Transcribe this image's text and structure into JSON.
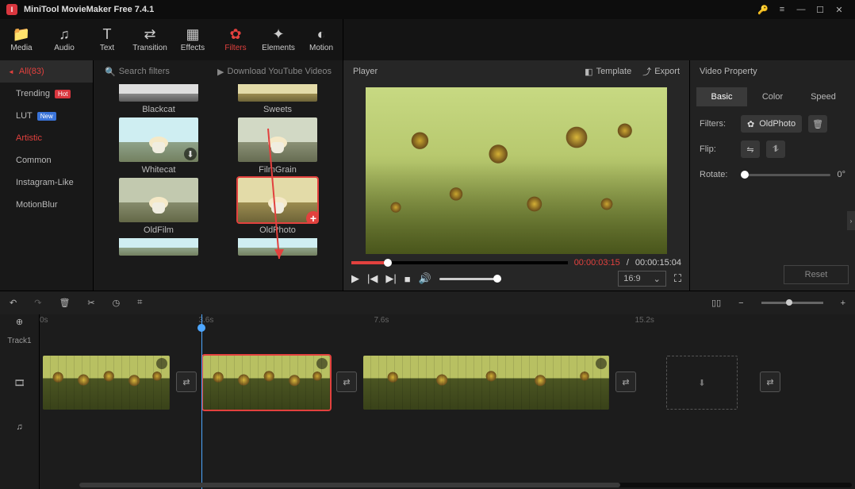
{
  "app": {
    "title": "MiniTool MovieMaker Free 7.4.1"
  },
  "toolbar": [
    {
      "icon": "📁",
      "label": "Media"
    },
    {
      "icon": "♫",
      "label": "Audio"
    },
    {
      "icon": "T",
      "label": "Text"
    },
    {
      "icon": "⇄",
      "label": "Transition"
    },
    {
      "icon": "▦",
      "label": "Effects"
    },
    {
      "icon": "✿",
      "label": "Filters",
      "active": true
    },
    {
      "icon": "✦",
      "label": "Elements"
    },
    {
      "icon": "◐",
      "label": "Motion"
    }
  ],
  "categories": {
    "head": "All(83)",
    "items": [
      {
        "label": "Trending",
        "badge": "Hot",
        "badgeClass": "hot"
      },
      {
        "label": "LUT",
        "badge": "New",
        "badgeClass": "new"
      },
      {
        "label": "Artistic",
        "active": true
      },
      {
        "label": "Common"
      },
      {
        "label": "Instagram-Like"
      },
      {
        "label": "MotionBlur"
      }
    ]
  },
  "search": {
    "placeholder": "Search filters"
  },
  "download": {
    "label": "Download YouTube Videos"
  },
  "filters": [
    {
      "name": "Blackcat",
      "style": "bw",
      "cut": true
    },
    {
      "name": "Sweets",
      "style": "sep",
      "cut": true
    },
    {
      "name": "Whitecat",
      "style": "",
      "dl": true
    },
    {
      "name": "FilmGrain",
      "style": "film"
    },
    {
      "name": "OldFilm",
      "style": "old"
    },
    {
      "name": "OldPhoto",
      "style": "sep",
      "selected": true,
      "add": true
    }
  ],
  "player": {
    "title": "Player",
    "template": "Template",
    "export": "Export",
    "current": "00:00:03:15",
    "total": "00:00:15:04",
    "aspect": "16:9"
  },
  "property": {
    "title": "Video Property",
    "tabs": [
      "Basic",
      "Color",
      "Speed"
    ],
    "activeTab": "Basic",
    "filtersLabel": "Filters:",
    "filterName": "OldPhoto",
    "flipLabel": "Flip:",
    "rotateLabel": "Rotate:",
    "rotateValue": "0°",
    "reset": "Reset"
  },
  "timeline": {
    "marks": [
      {
        "t": "0s",
        "pct": 0
      },
      {
        "t": "3.6s",
        "pct": 19.5
      },
      {
        "t": "7.6s",
        "pct": 41
      },
      {
        "t": "15.2s",
        "pct": 73
      }
    ],
    "trackLabel": "Track1"
  }
}
